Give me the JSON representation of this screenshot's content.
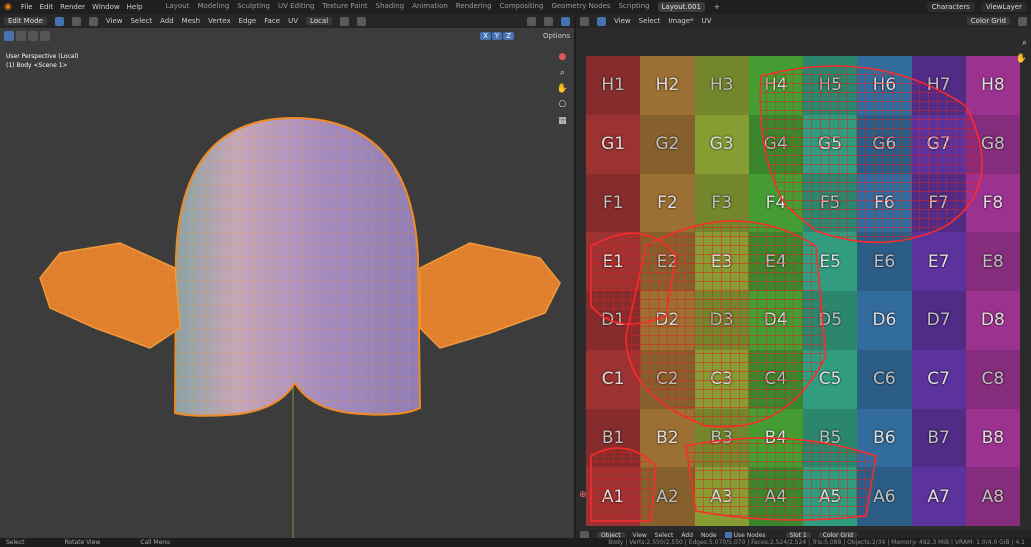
{
  "topbar": {
    "menus": [
      "File",
      "Edit",
      "Render",
      "Window",
      "Help"
    ],
    "workspaces": [
      "Layout",
      "Modeling",
      "Sculpting",
      "UV Editing",
      "Texture Paint",
      "Shading",
      "Animation",
      "Rendering",
      "Compositing",
      "Geometry Nodes",
      "Scripting",
      "Layout.001"
    ],
    "active_workspace": "Layout.001",
    "scene": "Characters",
    "view_layer": "ViewLayer"
  },
  "viewport_header": {
    "mode": "Edit Mode",
    "menus": [
      "View",
      "Select",
      "Add",
      "Mesh",
      "Vertex",
      "Edge",
      "Face",
      "UV"
    ],
    "transform": "Local",
    "axes": [
      "X",
      "Y",
      "Z"
    ],
    "options": "Options"
  },
  "viewport": {
    "perspective": "User Perspective (Local)",
    "object": "(1) Body <Scene 1>",
    "colors": {
      "bg": "#3c3c3c",
      "mesh": "#e8862a",
      "body": "#9f87b6"
    }
  },
  "uv_header": {
    "menus": [
      "View",
      "Select",
      "Image*",
      "UV"
    ],
    "image_name": "Color Grid"
  },
  "uv_grid": {
    "rows": [
      "H",
      "G",
      "F",
      "E",
      "D",
      "C",
      "B",
      "A"
    ],
    "cols": [
      "1",
      "2",
      "3",
      "4",
      "5",
      "6",
      "7",
      "8"
    ],
    "col_colors": [
      "#b33a3a",
      "#b3803a",
      "#9bb33a",
      "#4fb33a",
      "#3ab392",
      "#3a7cb3",
      "#6a3ab3",
      "#b33aa5"
    ]
  },
  "node_header": {
    "object": "Object",
    "menus": [
      "View",
      "Select",
      "Add",
      "Node"
    ],
    "use_nodes": "Use Nodes",
    "slot": "Slot 1",
    "material": "Color Grid"
  },
  "statusbar": {
    "select": "Select",
    "rotate": "Rotate View",
    "call_menu": "Call Menu",
    "stats": "Body | Verts:2,550/2,550 | Edges:5,070/5,070 | Faces:2,524/2,524 | Tris:5,088 | Objects:2/34 | Memory: 492.3 MiB | VRAM: 1.0/4.0 GiB | 4.1"
  }
}
